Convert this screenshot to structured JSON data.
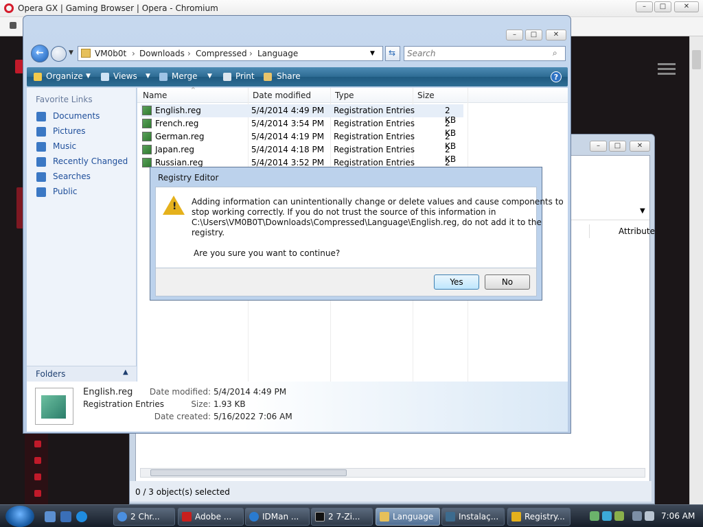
{
  "opera": {
    "title": "Opera GX | Gaming Browser | Opera - Chromium"
  },
  "explorer": {
    "breadcrumb": [
      "VM0b0t",
      "Downloads",
      "Compressed",
      "Language"
    ],
    "search_placeholder": "Search",
    "toolbar": {
      "organize": "Organize",
      "views": "Views",
      "merge": "Merge",
      "print": "Print",
      "share": "Share"
    },
    "favorites_title": "Favorite Links",
    "favorites": [
      "Documents",
      "Pictures",
      "Music",
      "Recently Changed",
      "Searches",
      "Public"
    ],
    "folders_label": "Folders",
    "columns": {
      "name": "Name",
      "date": "Date modified",
      "type": "Type",
      "size": "Size"
    },
    "files": [
      {
        "name": "English.reg",
        "date": "5/4/2014 4:49 PM",
        "type": "Registration Entries",
        "size": "2 KB"
      },
      {
        "name": "French.reg",
        "date": "5/4/2014 3:54 PM",
        "type": "Registration Entries",
        "size": "2 KB"
      },
      {
        "name": "German.reg",
        "date": "5/4/2014 4:19 PM",
        "type": "Registration Entries",
        "size": "2 KB"
      },
      {
        "name": "Japan.reg",
        "date": "5/4/2014 4:18 PM",
        "type": "Registration Entries",
        "size": "2 KB"
      },
      {
        "name": "Russian.reg",
        "date": "5/4/2014 3:52 PM",
        "type": "Registration Entries",
        "size": "2 KB"
      }
    ],
    "details": {
      "name": "English.reg",
      "type": "Registration Entries",
      "modified_label": "Date modified:",
      "modified": "5/4/2014 4:49 PM",
      "size_label": "Size:",
      "size": "1.93 KB",
      "created_label": "Date created:",
      "created": "5/16/2022 7:06 AM"
    }
  },
  "window2": {
    "attribute_header": "Attribute",
    "status": "0 / 3 object(s) selected"
  },
  "dialog": {
    "title": "Registry Editor",
    "lines": [
      "Adding information can unintentionally change or delete values and cause components to",
      "stop working correctly. If you do not trust the source of this information in",
      "C:\\Users\\VM0B0T\\Downloads\\Compressed\\Language\\English.reg, do not add it to the",
      "registry."
    ],
    "question": "Are you sure you want to continue?",
    "yes": "Yes",
    "no": "No"
  },
  "taskbar": {
    "tasks": [
      "2 Chr...",
      "Adobe ...",
      "IDMan ...",
      "2 7-Zi...",
      "Language",
      "Instalaç...",
      "Registry..."
    ],
    "clock": "7:06 AM"
  }
}
